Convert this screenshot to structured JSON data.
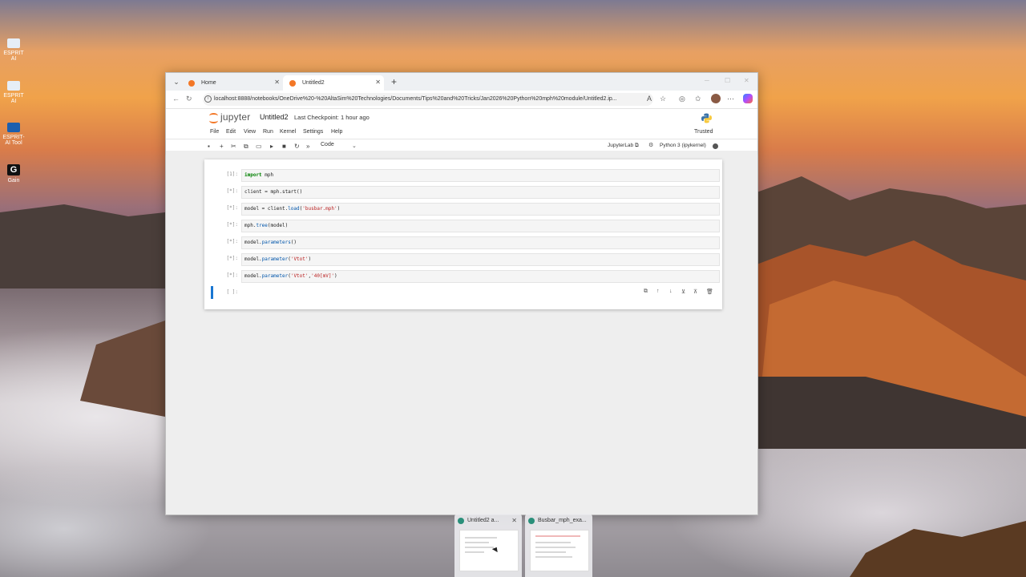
{
  "desktop": {
    "icons": [
      {
        "label": "ESPRIT AI"
      },
      {
        "label": "ESPRIT AI"
      },
      {
        "label": "ESPRIT-AI Tool"
      },
      {
        "label": "Gain"
      }
    ]
  },
  "browser": {
    "tabs": [
      {
        "label": "Home",
        "active": false
      },
      {
        "label": "Untitled2",
        "active": true
      }
    ],
    "url": "localhost:8888/notebooks/OneDrive%20-%20AltaSim%20Technologies/Documents/Tips%20and%20Tricks/Jan2026%20Python%20mph%20module/Untitled2.ip..."
  },
  "jupyter": {
    "brand": "jupyter",
    "notebook_title": "Untitled2",
    "checkpoint": "Last Checkpoint: 1 hour ago",
    "menu": [
      "File",
      "Edit",
      "View",
      "Run",
      "Kernel",
      "Settings",
      "Help"
    ],
    "trusted": "Trusted",
    "cell_type": "Code",
    "jupyterlab_link": "JupyterLab",
    "kernel_name": "Python 3 (ipykernel)",
    "cells": [
      {
        "prompt": "[1]:",
        "code": "import mph"
      },
      {
        "prompt": "[*]:",
        "code": "client = mph.start()"
      },
      {
        "prompt": "[*]:",
        "code": "model = client.load('busbar.mph')"
      },
      {
        "prompt": "[*]:",
        "code": "mph.tree(model)"
      },
      {
        "prompt": "[*]:",
        "code": "model.parameters()"
      },
      {
        "prompt": "[*]:",
        "code": "model.parameter('Vtot')"
      },
      {
        "prompt": "[*]:",
        "code": "model.parameter('Vtot','40[mV]')"
      },
      {
        "prompt": "[ ]:",
        "code": ""
      }
    ]
  },
  "taskbar_previews": [
    {
      "title": "Untitled2 a..."
    },
    {
      "title": "Busbar_mph_exa..."
    }
  ],
  "colors": {
    "jupyter_orange": "#f37726",
    "active_cell": "#1976d2"
  }
}
